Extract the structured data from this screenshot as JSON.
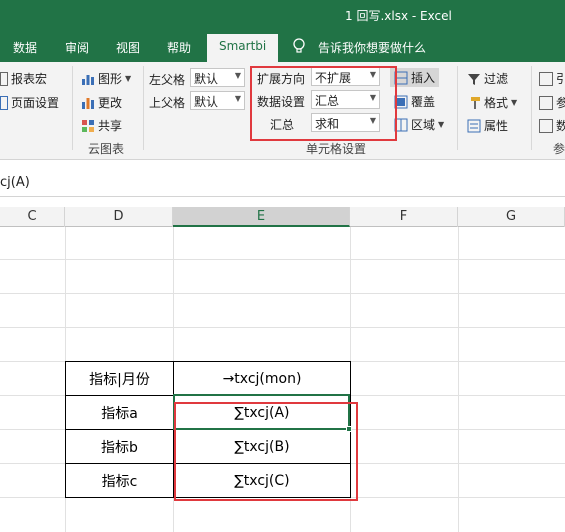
{
  "window": {
    "title": "1 回写.xlsx  -  Excel"
  },
  "tabs": [
    {
      "label": "数据"
    },
    {
      "label": "审阅"
    },
    {
      "label": "视图"
    },
    {
      "label": "帮助"
    },
    {
      "label": "Smartbi",
      "active": true
    },
    {
      "label": "告诉我你想要做什么"
    }
  ],
  "ribbon": {
    "report_macro": "报表宏",
    "page_setup": "页面设置",
    "chart": "图形",
    "change": "更改",
    "share": "共享",
    "cloud_chart_group": "云图表",
    "left_parent_label": "左父格",
    "left_parent_value": "默认",
    "top_parent_label": "上父格",
    "top_parent_value": "默认",
    "expand_dir_label": "扩展方向",
    "expand_dir_value": "不扩展",
    "data_setting_label": "数据设置",
    "data_setting_value": "汇总",
    "summary_label": "汇总",
    "summary_value": "求和",
    "cell_settings_group": "单元格设置",
    "insert": "插入",
    "overwrite": "覆盖",
    "region": "区域",
    "filter": "过滤",
    "format": "格式",
    "attribute": "属性",
    "partial_right_1": "引",
    "partial_right_2": "参",
    "partial_right_3": "数",
    "partial_right_group": "参"
  },
  "formula_bar": {
    "text": "cj(A)"
  },
  "columns": [
    "C",
    "D",
    "E",
    "F",
    "G"
  ],
  "table": {
    "header": {
      "label": "指标|月份",
      "formula": "→txcj(mon)"
    },
    "rows": [
      {
        "label": "指标a",
        "formula": "∑txcj(A)"
      },
      {
        "label": "指标b",
        "formula": "∑txcj(B)"
      },
      {
        "label": "指标c",
        "formula": "∑txcj(C)"
      }
    ]
  },
  "colors": {
    "excel_green": "#217346",
    "highlight_red": "#e0393e"
  }
}
